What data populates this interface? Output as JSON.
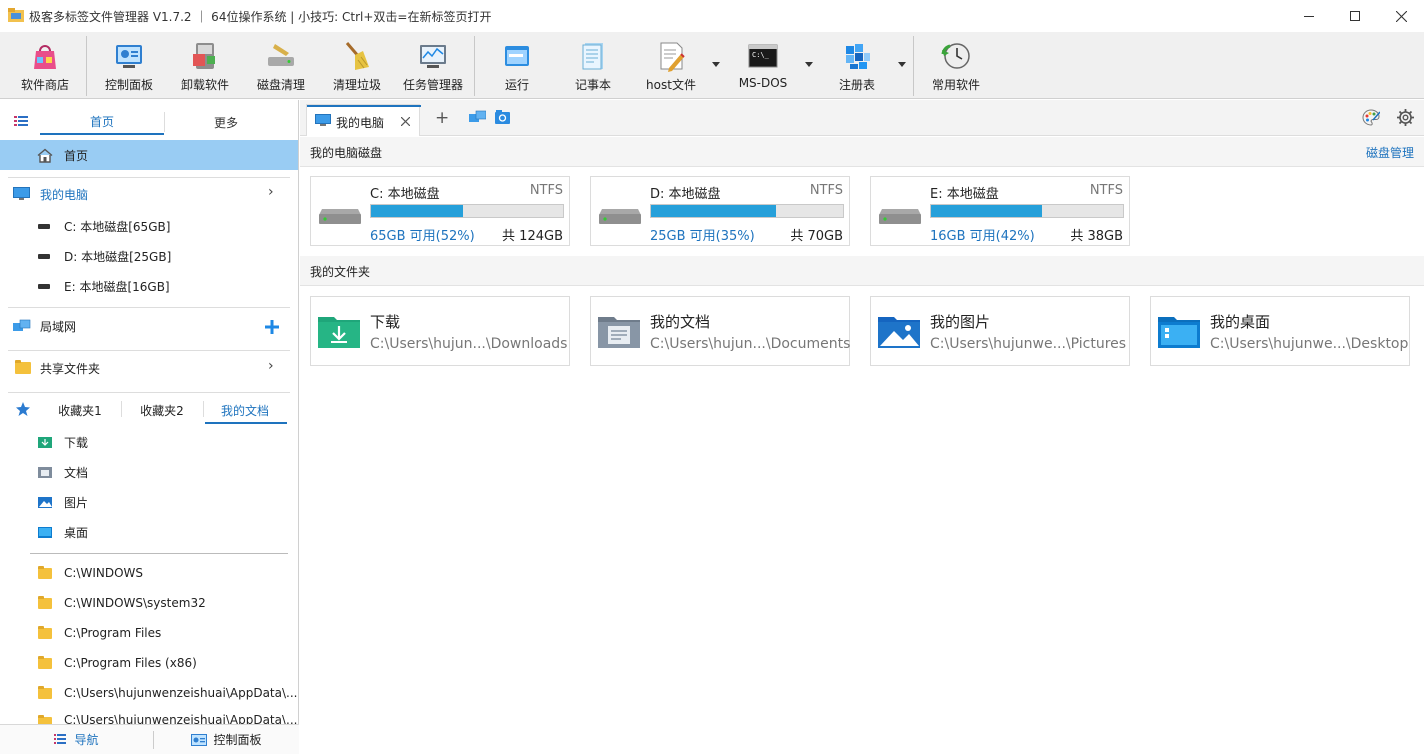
{
  "window": {
    "title": "极客多标签文件管理器 V1.7.2 ｜ 64位操作系统 | 小技巧: Ctrl+双击=在新标签页打开"
  },
  "toolbar": {
    "items": [
      {
        "label": "软件商店",
        "icon": "store-bag-icon"
      },
      {
        "label": "控制面板",
        "icon": "control-panel-icon"
      },
      {
        "label": "卸载软件",
        "icon": "uninstall-icon"
      },
      {
        "label": "磁盘清理",
        "icon": "disk-cleanup-icon"
      },
      {
        "label": "清理垃圾",
        "icon": "broom-icon"
      },
      {
        "label": "任务管理器",
        "icon": "task-manager-icon"
      },
      {
        "label": "运行",
        "icon": "run-icon"
      },
      {
        "label": "记事本",
        "icon": "notepad-icon"
      },
      {
        "label": "host文件",
        "icon": "hosts-file-icon"
      },
      {
        "label": "MS-DOS",
        "icon": "cmd-icon"
      },
      {
        "label": "注册表",
        "icon": "registry-icon"
      },
      {
        "label": "常用软件",
        "icon": "common-software-icon"
      }
    ]
  },
  "sidebar": {
    "top_tabs": [
      "首页",
      "更多"
    ],
    "home": "首页",
    "my_computer": "我的电脑",
    "drives": [
      "C: 本地磁盘[65GB]",
      "D: 本地磁盘[25GB]",
      "E: 本地磁盘[16GB]"
    ],
    "lan": "局域网",
    "shared": "共享文件夹",
    "fav_tabs": [
      "收藏夹1",
      "收藏夹2",
      "我的文档"
    ],
    "docs": [
      "下载",
      "文档",
      "图片",
      "桌面"
    ],
    "paths": [
      "C:\\WINDOWS",
      "C:\\WINDOWS\\system32",
      "C:\\Program Files",
      "C:\\Program Files (x86)",
      "C:\\Users\\hujunwenzeishuai\\AppData\\...",
      "C:\\Users\\hujunwenzeishuai\\AppData\\..."
    ]
  },
  "bottom": {
    "nav": "导航",
    "control": "控制面板"
  },
  "tabs": {
    "active": "我的电脑",
    "add": "+"
  },
  "main": {
    "disks_title": "我的电脑磁盘",
    "disk_manage": "磁盘管理",
    "disks": [
      {
        "name": "C: 本地磁盘",
        "fs": "NTFS",
        "free": "65GB 可用(52%)",
        "total": "共 124GB",
        "used_fraction": 0.48
      },
      {
        "name": "D: 本地磁盘",
        "fs": "NTFS",
        "free": "25GB 可用(35%)",
        "total": "共 70GB",
        "used_fraction": 0.65
      },
      {
        "name": "E: 本地磁盘",
        "fs": "NTFS",
        "free": "16GB 可用(42%)",
        "total": "共 38GB",
        "used_fraction": 0.58
      }
    ],
    "folders_title": "我的文件夹",
    "folders": [
      {
        "name": "下载",
        "path": "C:\\Users\\hujun...\\Downloads"
      },
      {
        "name": "我的文档",
        "path": "C:\\Users\\hujun...\\Documents"
      },
      {
        "name": "我的图片",
        "path": "C:\\Users\\hujunwe...\\Pictures"
      },
      {
        "name": "我的桌面",
        "path": "C:\\Users\\hujunwe...\\Desktop"
      }
    ]
  },
  "colors": {
    "accent": "#26a0da",
    "selected_row": "#99ccf3",
    "link": "#1e73be"
  }
}
